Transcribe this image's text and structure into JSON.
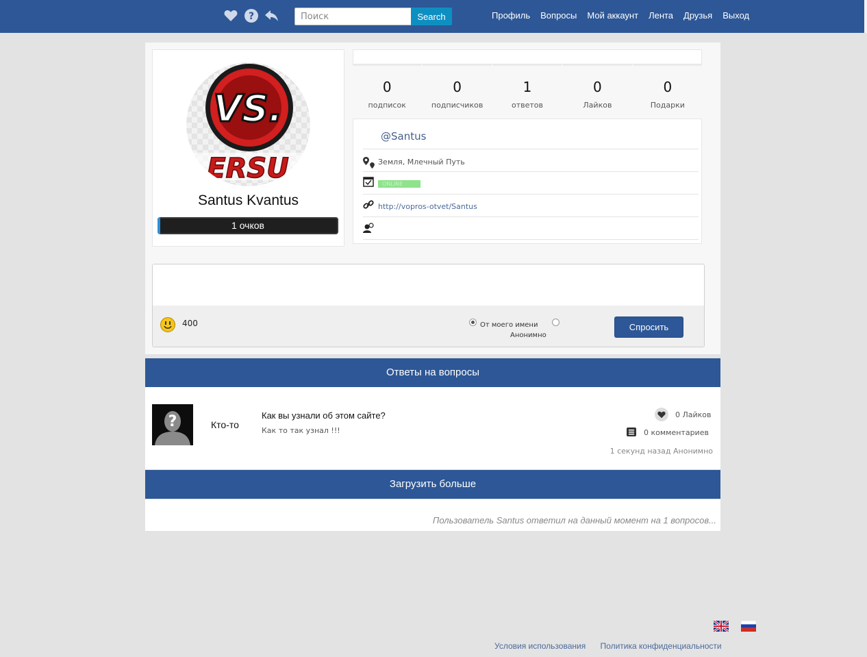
{
  "colors": {
    "header": "#2d5796",
    "search_button": "#0e8fc2",
    "online": "#8ee38c"
  },
  "header": {
    "icons": [
      "heart-icon",
      "help-icon",
      "back-icon"
    ],
    "search": {
      "placeholder": "Поиск",
      "button": "Search"
    },
    "nav": [
      "Профиль",
      "Вопросы",
      "Мой аккаунт",
      "Лента",
      "Друзья",
      "Выход"
    ]
  },
  "profile": {
    "name": "Santus Kvantus",
    "points_label": "1 очков",
    "avatar_text": "VS.",
    "avatar_banner": "ERSU",
    "stats": [
      {
        "value": "0",
        "label": "подписок"
      },
      {
        "value": "0",
        "label": "подписчиков"
      },
      {
        "value": "1",
        "label": "ответов"
      },
      {
        "value": "0",
        "label": "Лайков"
      },
      {
        "value": "0",
        "label": "Подарки"
      }
    ],
    "username": "@Santus",
    "location": "Земля, Млечный Путь",
    "status": "ONLINE",
    "link": "http://vopros-otvet/Santus"
  },
  "ask": {
    "coins": "400",
    "options": [
      "От моего имени",
      "Анонимно"
    ],
    "selected": "От моего имени",
    "submit": "Спросить"
  },
  "answers_section": {
    "title": "Ответы на вопросы",
    "items": [
      {
        "author": "Кто-то",
        "question": "Как вы узнали об этом сайте?",
        "answer": "Как то так узнал !!!",
        "likes": "0 Лайков",
        "comments": "0 комментариев",
        "time": "1 секунд назад Анонимно"
      }
    ],
    "load_more": "Загрузить больше",
    "summary": "Пользователь Santus ответил на данный момент на 1 вопросов..."
  },
  "footer": {
    "languages": [
      "English",
      "Русский"
    ],
    "links": [
      "Условия использования",
      "Политика конфиденциальности"
    ]
  }
}
